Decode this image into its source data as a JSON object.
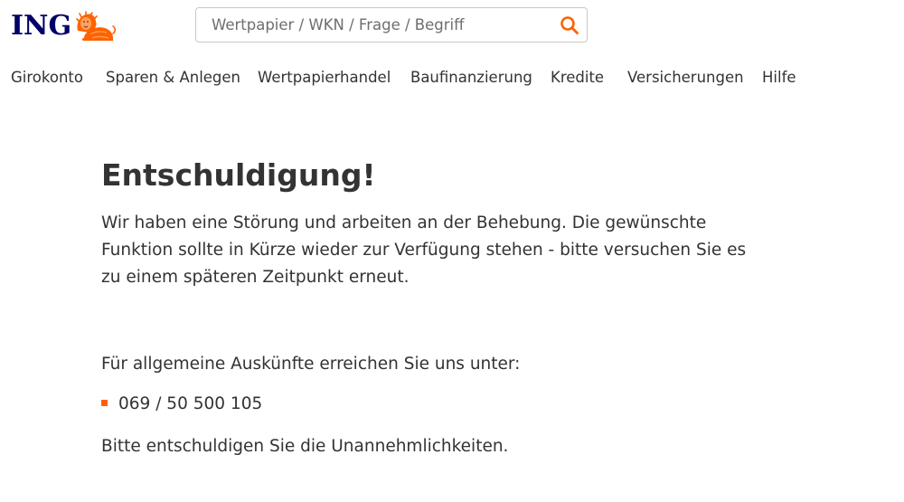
{
  "header": {
    "logo_text": "ING",
    "search": {
      "placeholder": "Wertpapier / WKN / Frage / Begriff",
      "value": ""
    }
  },
  "nav": {
    "items": [
      {
        "label": "Girokonto"
      },
      {
        "label": "Sparen & Anlegen"
      },
      {
        "label": "Wertpapierhandel"
      },
      {
        "label": "Baufinanzierung"
      },
      {
        "label": "Kredite"
      },
      {
        "label": "Versicherungen"
      },
      {
        "label": "Hilfe"
      }
    ]
  },
  "main": {
    "title": "Entschuldigung!",
    "message": "Wir haben eine Störung und arbeiten an der Behebung. Die gewünschte Funktion sollte in Kürze wieder zur Verfügung stehen - bitte versuchen Sie es zu einem späteren Zeitpunkt erneut.",
    "contact_intro": "Für allgemeine Auskünfte erreichen Sie uns unter:",
    "contacts": [
      {
        "phone": "069 / 50 500 105"
      }
    ],
    "apology": "Bitte entschuldigen Sie die Unannehmlichkeiten."
  },
  "icons": {
    "logo": "lion-icon",
    "search": "search-icon",
    "bullet": "square-bullet-icon"
  },
  "colors": {
    "brand_orange": "#ff6200",
    "brand_navy": "#000066",
    "text": "#333333",
    "input_border": "#c9c9c9"
  }
}
